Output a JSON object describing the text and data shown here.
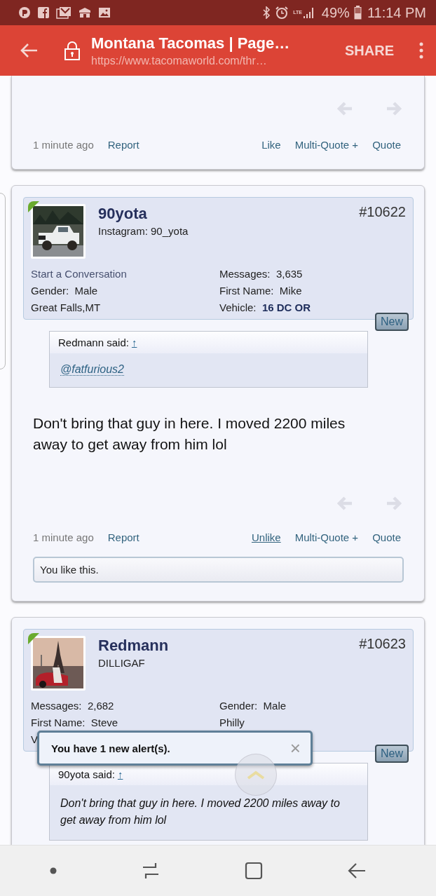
{
  "status_bar": {
    "lte": "LTE",
    "battery": "49%",
    "time": "11:14 PM"
  },
  "toolbar": {
    "title": "Montana Tacomas | Page…",
    "url": "https://www.tacomaworld.com/thr…",
    "share": "SHARE"
  },
  "posts": [
    {
      "kind": "footer_only",
      "time": "1 minute ago",
      "report": "Report",
      "actions": [
        {
          "label": "Like",
          "active": false
        },
        {
          "label": "Multi-Quote +",
          "active": false
        },
        {
          "label": "Quote",
          "active": false
        }
      ]
    },
    {
      "kind": "full",
      "author": "90yota",
      "subtitle": "Instagram: 90_yota",
      "number": "#10622",
      "online": true,
      "info": [
        {
          "kind": "link",
          "text": "Start a Conversation"
        },
        {
          "kind": "field",
          "label": "Messages:",
          "value": "3,635",
          "emphasis": false
        },
        {
          "kind": "field",
          "label": "Gender:",
          "value": "Male",
          "emphasis": false
        },
        {
          "kind": "field",
          "label": "First Name:",
          "value": "Mike",
          "emphasis": false
        },
        {
          "kind": "text",
          "text": "Great Falls,MT"
        },
        {
          "kind": "field",
          "label": "Vehicle:",
          "value": "16 DC OR",
          "emphasis": true
        }
      ],
      "badge": "New",
      "quote": {
        "author": "Redmann said:",
        "arrow": "↑",
        "mention": "@fatfurious2"
      },
      "text": "Don't bring that guy in here. I moved 2200 miles away to get away from him lol",
      "time": "1 minute ago",
      "report": "Report",
      "actions": [
        {
          "label": "Unlike",
          "active": true
        },
        {
          "label": "Multi-Quote +",
          "active": false
        },
        {
          "label": "Quote",
          "active": false
        }
      ],
      "like_note": "You like this."
    },
    {
      "kind": "full",
      "author": "Redmann",
      "subtitle": "DILLIGAF",
      "number": "#10623",
      "online": true,
      "info": [
        {
          "kind": "field",
          "label": "Messages:",
          "value": "2,682",
          "emphasis": false
        },
        {
          "kind": "field",
          "label": "Gender:",
          "value": "Male",
          "emphasis": false
        },
        {
          "kind": "field",
          "label": "First Name:",
          "value": "Steve",
          "emphasis": false
        },
        {
          "kind": "text",
          "text": "Philly"
        },
        {
          "kind": "text",
          "text": "V"
        }
      ],
      "badge": "New",
      "quote": {
        "author": "90yota said:",
        "arrow": "↑",
        "body": "Don't bring that guy in here. I moved 2200 miles away to get away from him lol"
      }
    }
  ],
  "alert": {
    "text": "You have 1 new alert(s).",
    "close": "×"
  }
}
